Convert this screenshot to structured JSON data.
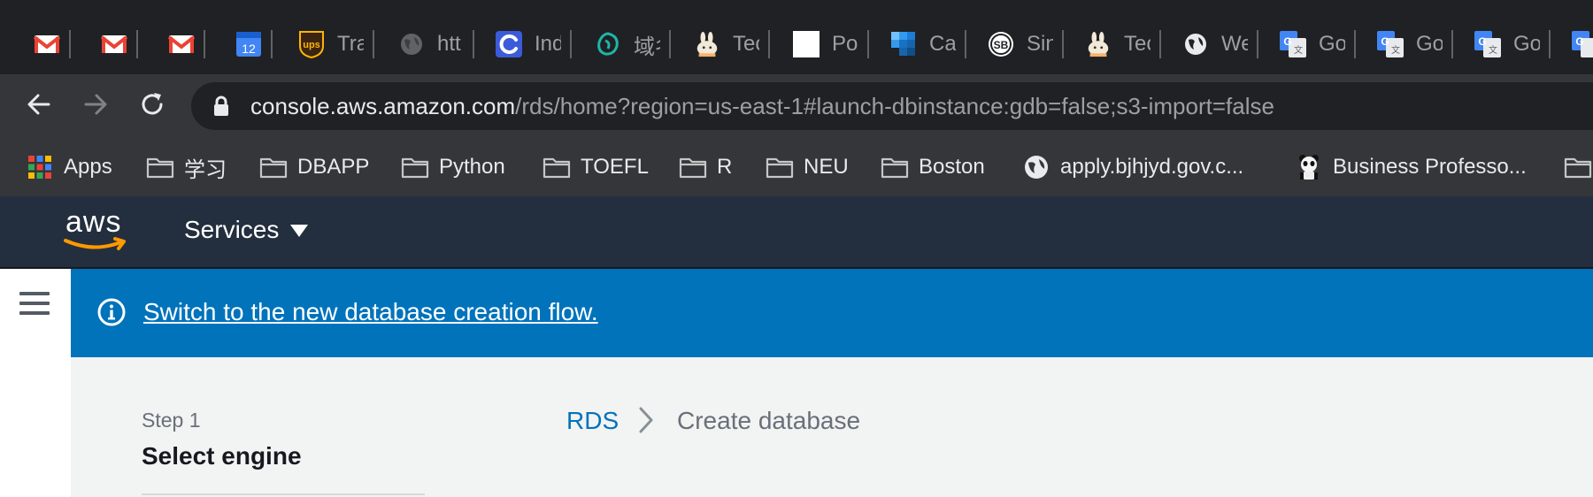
{
  "browser": {
    "tabs": [
      {
        "title": "",
        "icon": "gmail-icon"
      },
      {
        "title": "",
        "icon": "gmail-icon"
      },
      {
        "title": "",
        "icon": "gmail-icon"
      },
      {
        "title": "",
        "icon": "calendar-icon",
        "badge": "12"
      },
      {
        "title": "Tra",
        "icon": "ups-icon",
        "badge": "ups"
      },
      {
        "title": "htt",
        "icon": "globe-icon"
      },
      {
        "title": "Ind",
        "icon": "swirl-icon"
      },
      {
        "title": "域名",
        "icon": "teal-logo-icon"
      },
      {
        "title": "Tec",
        "icon": "rabbit-icon"
      },
      {
        "title": "Po",
        "icon": "blank-page-icon"
      },
      {
        "title": "Ca",
        "icon": "mosaic-icon"
      },
      {
        "title": "Sin",
        "icon": "sb-icon",
        "badge": "SB"
      },
      {
        "title": "Tec",
        "icon": "rabbit-icon"
      },
      {
        "title": "We",
        "icon": "globe-icon"
      },
      {
        "title": "Go",
        "icon": "translate-icon",
        "badge": "G"
      },
      {
        "title": "Go",
        "icon": "translate-icon",
        "badge": "G"
      },
      {
        "title": "Go",
        "icon": "translate-icon",
        "badge": "G"
      },
      {
        "title": "",
        "icon": "translate-icon",
        "badge": "G"
      }
    ],
    "url_host": "console.aws.amazon.com",
    "url_path": "/rds/home?region=us-east-1#launch-dbinstance:gdb=false;s3-import=false",
    "bookmarks": [
      {
        "label": "Apps",
        "icon": "apps-grid-icon"
      },
      {
        "label": "学习",
        "icon": "folder-icon"
      },
      {
        "label": "DBAPP",
        "icon": "folder-icon"
      },
      {
        "label": "Python",
        "icon": "folder-icon"
      },
      {
        "label": "TOEFL",
        "icon": "folder-icon"
      },
      {
        "label": "R",
        "icon": "folder-icon"
      },
      {
        "label": "NEU",
        "icon": "folder-icon"
      },
      {
        "label": "Boston",
        "icon": "folder-icon"
      },
      {
        "label": "apply.bjhjyd.gov.c...",
        "icon": "globe-icon"
      },
      {
        "label": "Business Professo...",
        "icon": "panda-icon"
      },
      {
        "label": "",
        "icon": "folder-icon"
      }
    ]
  },
  "aws": {
    "logo_text": "aws",
    "services_label": "Services",
    "flash_link": "Switch to the new database creation flow.",
    "step_number": "Step 1",
    "step_name": "Select engine",
    "breadcrumb_root": "RDS",
    "breadcrumb_current": "Create database"
  },
  "colors": {
    "tab_strip": "#202124",
    "toolbar": "#35363a",
    "aws_header": "#232f3e",
    "aws_orange": "#ff9900",
    "flash_blue": "#0073bb",
    "link_blue": "#0073bb",
    "page_bg": "#f2f3f3"
  }
}
